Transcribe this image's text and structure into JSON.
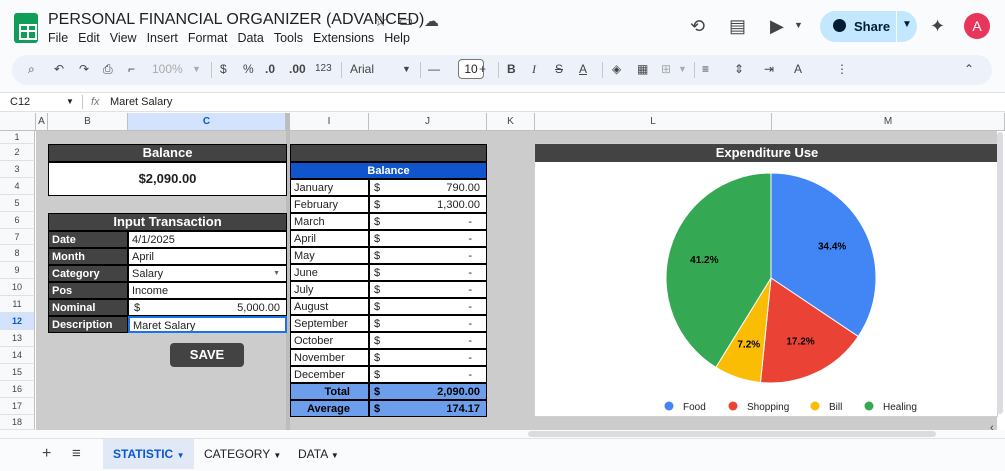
{
  "doc": {
    "title": "PERSONAL FINANCIAL ORGANIZER (ADVANCED)",
    "menus": [
      "File",
      "Edit",
      "View",
      "Insert",
      "Format",
      "Data",
      "Tools",
      "Extensions",
      "Help"
    ],
    "share_label": "Share",
    "avatar_letter": "A"
  },
  "toolbar": {
    "zoom": "100%",
    "currency": "$",
    "percent": "%",
    "dec_less": ".0",
    "dec_more": ".00",
    "num_fmt": "123",
    "font": "Arial",
    "font_size": "10"
  },
  "formula_bar": {
    "cell_ref": "C12",
    "fx": "fx",
    "value": "Maret Salary"
  },
  "columns": [
    "A",
    "B",
    "C",
    "I",
    "J",
    "K",
    "L",
    "M"
  ],
  "rows": [
    "1",
    "2",
    "3",
    "4",
    "5",
    "6",
    "7",
    "8",
    "9",
    "10",
    "11",
    "12",
    "13",
    "14",
    "15",
    "16",
    "17",
    "18"
  ],
  "balance_box": {
    "header": "Balance",
    "value": "$2,090.00"
  },
  "input_form": {
    "header": "Input Transaction",
    "fields": [
      {
        "label": "Date",
        "value": "4/1/2025"
      },
      {
        "label": "Month",
        "value": "April"
      },
      {
        "label": "Category",
        "value": "Salary"
      },
      {
        "label": "Pos",
        "value": "Income"
      },
      {
        "label": "Nominal",
        "currency": "$",
        "value": "5,000.00"
      },
      {
        "label": "Description",
        "value": "Maret Salary"
      }
    ],
    "save_label": "SAVE"
  },
  "monthly": {
    "header": "Balance",
    "currency": "$",
    "rows": [
      {
        "month": "January",
        "value": "790.00"
      },
      {
        "month": "February",
        "value": "1,300.00"
      },
      {
        "month": "March",
        "value": "-"
      },
      {
        "month": "April",
        "value": "-"
      },
      {
        "month": "May",
        "value": "-"
      },
      {
        "month": "June",
        "value": "-"
      },
      {
        "month": "July",
        "value": "-"
      },
      {
        "month": "August",
        "value": "-"
      },
      {
        "month": "September",
        "value": "-"
      },
      {
        "month": "October",
        "value": "-"
      },
      {
        "month": "November",
        "value": "-"
      },
      {
        "month": "December",
        "value": "-"
      }
    ],
    "total_label": "Total",
    "total_value": "2,090.00",
    "average_label": "Average",
    "average_value": "174.17"
  },
  "chart_data": {
    "type": "pie",
    "title": "Expenditure Use",
    "categories": [
      "Food",
      "Shopping",
      "Bill",
      "Healing"
    ],
    "values": [
      34.4,
      17.2,
      7.2,
      41.2
    ],
    "labels": [
      "34.4%",
      "17.2%",
      "7.2%",
      "41.2%"
    ],
    "colors": [
      "#4285f4",
      "#ea4335",
      "#fbbc04",
      "#34a853"
    ],
    "legend": "bottom"
  },
  "sheets": [
    {
      "name": "STATISTIC",
      "active": true
    },
    {
      "name": "CATEGORY",
      "active": false
    },
    {
      "name": "DATA",
      "active": false
    }
  ]
}
